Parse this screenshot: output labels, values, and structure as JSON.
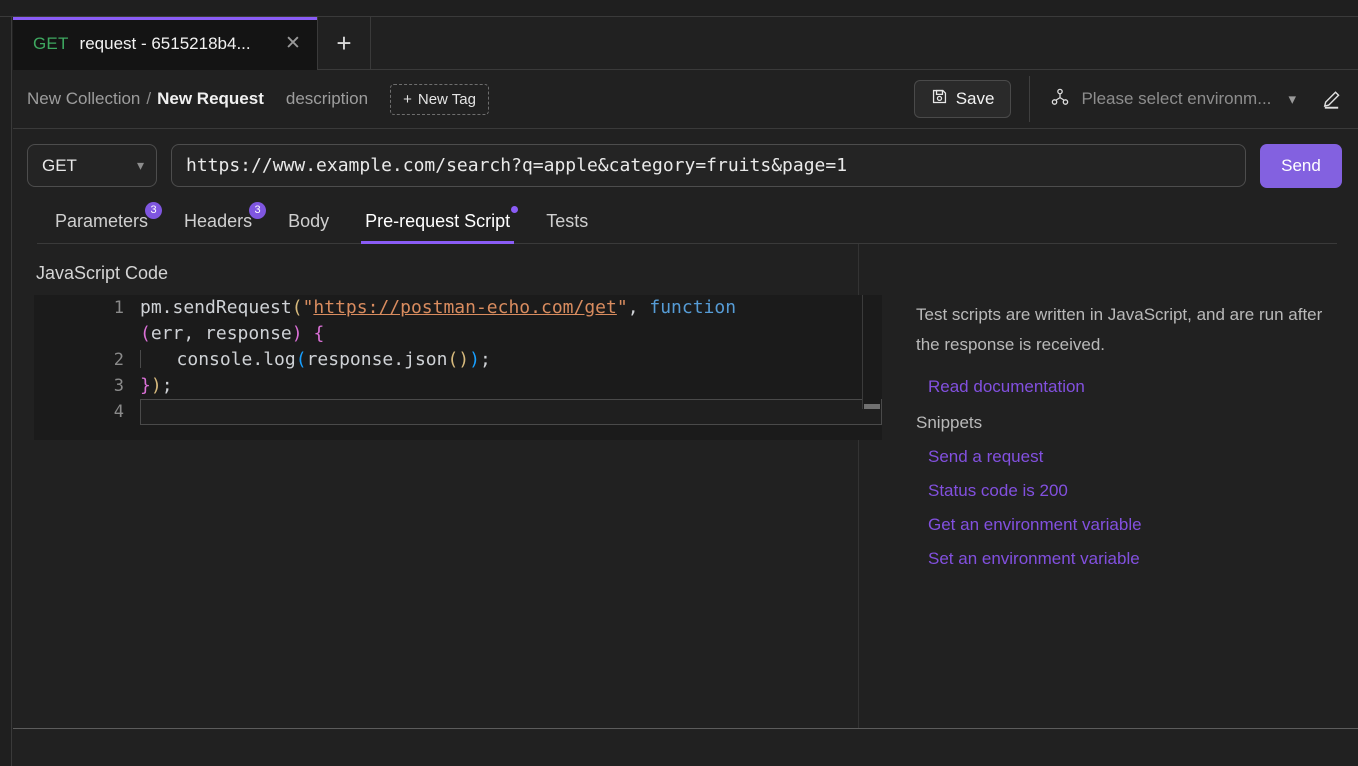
{
  "tab_bar": {
    "tabs": [
      {
        "method": "GET",
        "title": "request - 6515218b4...",
        "close_icon": "close-icon"
      }
    ],
    "new_tab_icon": "plus-icon"
  },
  "breadcrumb": {
    "collection": "New Collection",
    "separator": "/",
    "request": "New Request",
    "description_placeholder": "description",
    "new_tag_label": "New Tag",
    "new_tag_plus": "+"
  },
  "toolbar": {
    "save_label": "Save",
    "save_icon": "floppy-disk-icon",
    "environment_icon": "environment-node-icon",
    "environment_value": "Please select environm...",
    "environment_chevron": "chevron-down-icon",
    "edit_icon": "pencil-edit-icon"
  },
  "request": {
    "method": "GET",
    "method_chevron": "chevron-down-icon",
    "url": "https://www.example.com/search?q=apple&category=fruits&page=1",
    "url_placeholder": "Enter request URL",
    "send_label": "Send"
  },
  "section_tabs": [
    {
      "label": "Parameters",
      "badge": "3",
      "active": false
    },
    {
      "label": "Headers",
      "badge": "3",
      "active": false
    },
    {
      "label": "Body",
      "badge": "",
      "active": false
    },
    {
      "label": "Pre-request Script",
      "badge": "",
      "dot": true,
      "active": true
    },
    {
      "label": "Tests",
      "badge": "",
      "active": false
    }
  ],
  "editor": {
    "pane_label": "JavaScript Code",
    "line_numbers": [
      "1",
      "2",
      "3",
      "4"
    ],
    "code_lines": [
      "pm.sendRequest(\"https://postman-echo.com/get\", function (err, response) {",
      "    console.log(response.json());",
      "});",
      ""
    ],
    "string_literal": "https://postman-echo.com/get",
    "active_line": 4
  },
  "help": {
    "paragraph": "Test scripts are written in JavaScript, and are run after the response is received.",
    "doc_link": "Read documentation",
    "snippets_heading": "Snippets",
    "snippets": [
      "Send a request",
      "Status code is 200",
      "Get an environment variable",
      "Set an environment variable"
    ]
  },
  "colors": {
    "accent_purple": "#8a5cf6",
    "send_purple": "#8361e0",
    "link_purple": "#8250df",
    "method_green": "#3ea860",
    "background": "#212121",
    "editor_background": "#1b1b1b",
    "string_orange": "#d98c5f",
    "keyword_blue": "#569cd6"
  }
}
